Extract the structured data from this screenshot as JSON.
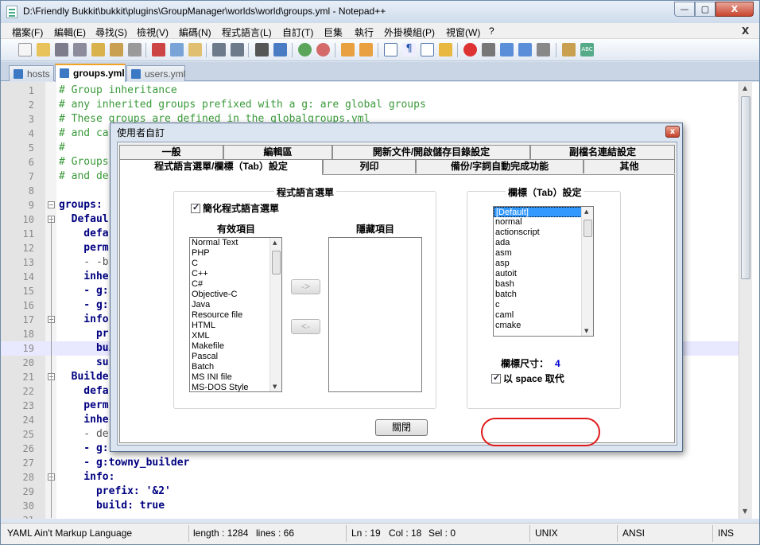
{
  "window": {
    "title": "D:\\Friendly Bukkit\\bukkit\\plugins\\GroupManager\\worlds\\world\\groups.yml - Notepad++",
    "minimize_glyph": "—",
    "maximize_glyph": "▢",
    "close_glyph": "X"
  },
  "menubar": {
    "items": [
      "檔案(F)",
      "編輯(E)",
      "尋找(S)",
      "檢視(V)",
      "編碼(N)",
      "程式語言(L)",
      "自訂(T)",
      "巨集",
      "執行",
      "外掛模組(P)",
      "視窗(W)",
      "?"
    ],
    "close_glyph": "X"
  },
  "tabs": [
    {
      "label": "hosts",
      "active": false
    },
    {
      "label": "groups.yml",
      "active": true
    },
    {
      "label": "users.yml",
      "active": false
    }
  ],
  "editor": {
    "lines": [
      {
        "n": "1",
        "text": "# Group inheritance",
        "type": "comment"
      },
      {
        "n": "2",
        "text": "# any inherited groups prefixed with a g: are global groups",
        "type": "comment"
      },
      {
        "n": "3",
        "text": "# These groups are defined in the globalgroups.yml",
        "type": "comment"
      },
      {
        "n": "4",
        "text": "# and ca",
        "type": "comment"
      },
      {
        "n": "5",
        "text": "#",
        "type": "comment"
      },
      {
        "n": "6",
        "text": "# Groups",
        "type": "comment"
      },
      {
        "n": "7",
        "text": "# and de",
        "type": "comment"
      },
      {
        "n": "8",
        "text": "",
        "type": "plain"
      },
      {
        "n": "9",
        "text": "groups:",
        "type": "key"
      },
      {
        "n": "10",
        "text": "  Defaul",
        "type": "key"
      },
      {
        "n": "11",
        "text": "    defa",
        "type": "key"
      },
      {
        "n": "12",
        "text": "    perm",
        "type": "key"
      },
      {
        "n": "13",
        "text": "    - -b",
        "type": "plain"
      },
      {
        "n": "14",
        "text": "    inhe",
        "type": "key"
      },
      {
        "n": "15",
        "text": "    - g:",
        "type": "key"
      },
      {
        "n": "16",
        "text": "    - g:",
        "type": "key"
      },
      {
        "n": "17",
        "text": "    info",
        "type": "key"
      },
      {
        "n": "18",
        "text": "      pr",
        "type": "key"
      },
      {
        "n": "19",
        "text": "      bui",
        "type": "key"
      },
      {
        "n": "20",
        "text": "      su",
        "type": "key"
      },
      {
        "n": "21",
        "text": "  Builde",
        "type": "key"
      },
      {
        "n": "22",
        "text": "    defa",
        "type": "key"
      },
      {
        "n": "23",
        "text": "    perm",
        "type": "key"
      },
      {
        "n": "24",
        "text": "    inhe",
        "type": "key"
      },
      {
        "n": "25",
        "text": "    - de",
        "type": "plain"
      },
      {
        "n": "26",
        "text": "    - g:",
        "type": "key"
      },
      {
        "n": "27",
        "text": "    - g:towny_builder",
        "type": "mixed"
      },
      {
        "n": "28",
        "text": "    info:",
        "type": "key"
      },
      {
        "n": "29",
        "text": "      prefix: '&2'",
        "type": "prefix"
      },
      {
        "n": "30",
        "text": "      build: true",
        "type": "build"
      },
      {
        "n": "31",
        "text": "",
        "type": "plain"
      }
    ]
  },
  "statusbar": {
    "language": "YAML Ain't Markup Language",
    "length": "length : 1284",
    "lines": "lines : 66",
    "ln": "Ln : 19",
    "col": "Col : 18",
    "sel": "Sel : 0",
    "eol": "UNIX",
    "encoding": "ANSI",
    "mode": "INS"
  },
  "dialog": {
    "title": "使用者自訂",
    "close_glyph": "x",
    "tabs_row1": [
      "一般",
      "編輯區",
      "開新文件/開啟儲存目錄設定",
      "副檔名連結設定"
    ],
    "tabs_row2": [
      "程式語言選單/欄標（Tab）設定",
      "列印",
      "備份/字詞自動完成功能",
      "其他"
    ],
    "lang_menu": {
      "group_label": "程式語言選單",
      "compact_checkbox": "簡化程式語言選單",
      "available_label": "有效項目",
      "hidden_label": "隱藏項目",
      "available_items": [
        "Normal Text",
        "PHP",
        "C",
        "C++",
        "C#",
        "Objective-C",
        "Java",
        "Resource file",
        "HTML",
        "XML",
        "Makefile",
        "Pascal",
        "Batch",
        "MS INI file",
        "MS-DOS Style"
      ],
      "hidden_items": [],
      "move_right": "->",
      "move_left": "<-"
    },
    "tab_settings": {
      "group_label": "欄標（Tab）設定",
      "items": [
        "[Default]",
        "normal",
        "actionscript",
        "ada",
        "asm",
        "asp",
        "autoit",
        "bash",
        "batch",
        "c",
        "caml",
        "cmake"
      ],
      "selected_index": 0,
      "tab_size_label": "欄標尺寸：",
      "tab_size_value": "4",
      "replace_checkbox": "以 space 取代"
    },
    "close_button": "關閉"
  }
}
